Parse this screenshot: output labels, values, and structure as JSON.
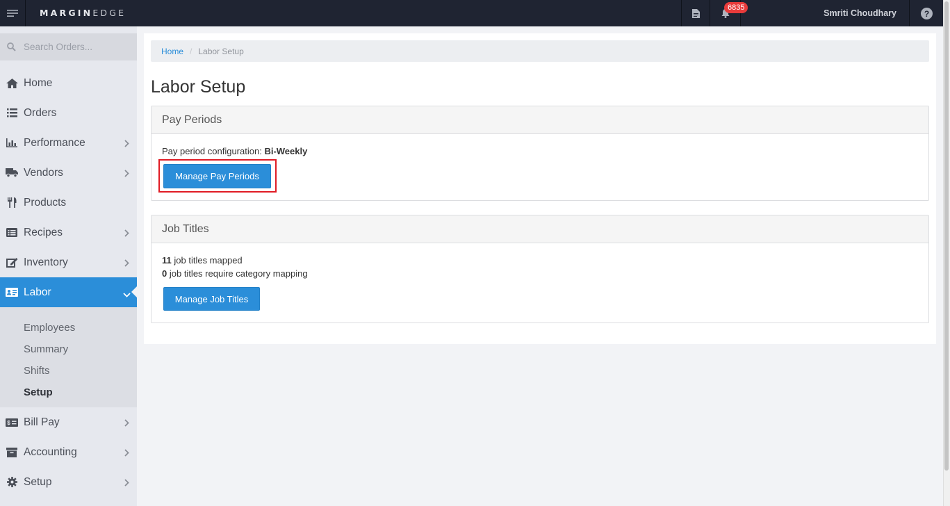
{
  "topbar": {
    "logo_bold": "MARGIN",
    "logo_light": "EDGE",
    "notification_count": "6835",
    "user_name": "Smriti Choudhary"
  },
  "sidebar": {
    "search_placeholder": "Search Orders...",
    "items": [
      {
        "label": "Home",
        "icon": "home-icon"
      },
      {
        "label": "Orders",
        "icon": "list-icon"
      },
      {
        "label": "Performance",
        "icon": "bar-chart-icon"
      },
      {
        "label": "Vendors",
        "icon": "truck-icon"
      },
      {
        "label": "Products",
        "icon": "utensils-icon"
      },
      {
        "label": "Recipes",
        "icon": "recipe-card-icon"
      },
      {
        "label": "Inventory",
        "icon": "edit-icon"
      },
      {
        "label": "Labor",
        "icon": "id-card-icon"
      },
      {
        "label": "Bill Pay",
        "icon": "money-icon"
      },
      {
        "label": "Accounting",
        "icon": "archive-icon"
      },
      {
        "label": "Setup",
        "icon": "gear-icon"
      }
    ],
    "labor_sub": [
      "Employees",
      "Summary",
      "Shifts",
      "Setup"
    ]
  },
  "breadcrumb": {
    "home": "Home",
    "current": "Labor Setup"
  },
  "page_title": "Labor Setup",
  "pay_periods": {
    "title": "Pay Periods",
    "config_label": "Pay period configuration:",
    "config_value": "Bi-Weekly",
    "button": "Manage Pay Periods"
  },
  "job_titles": {
    "title": "Job Titles",
    "mapped_count": "11",
    "mapped_text": "job titles mapped",
    "unmapped_count": "0",
    "unmapped_text": "job titles require category mapping",
    "button": "Manage Job Titles"
  },
  "colors": {
    "accent": "#2b8ed9",
    "topbar": "#1f2432",
    "badge": "#e83b3b",
    "highlight": "#e01b24"
  }
}
